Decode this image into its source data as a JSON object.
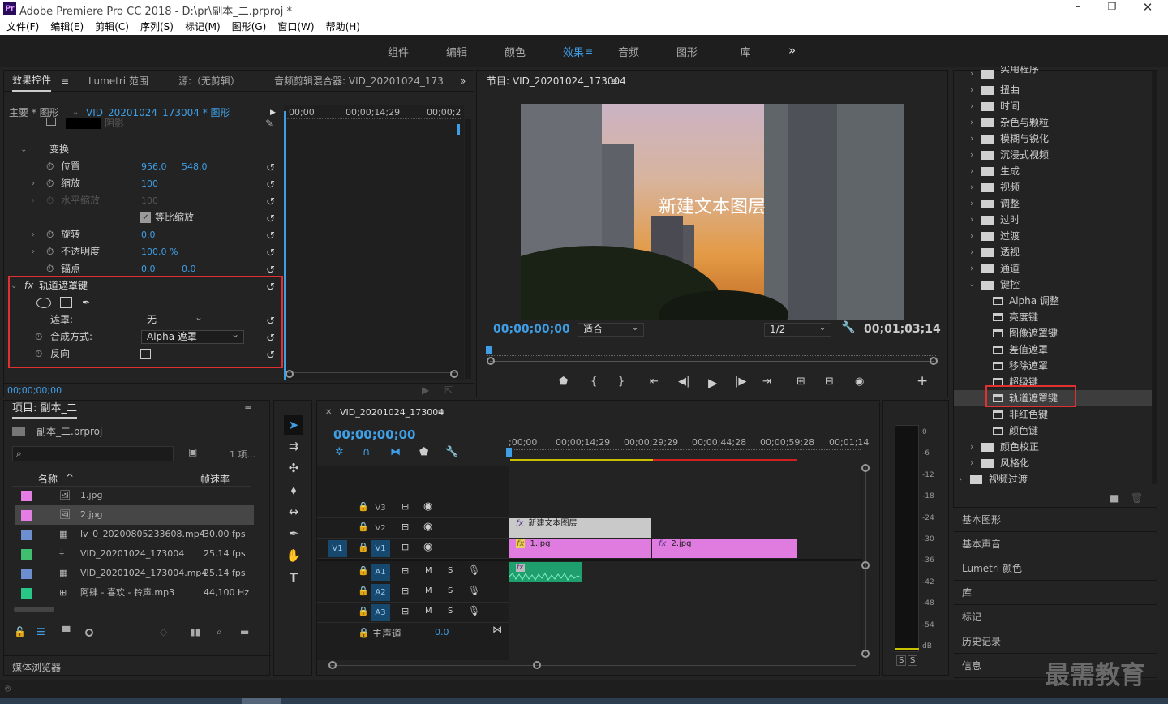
{
  "app": {
    "title": "Adobe Premiere Pro CC 2018 - D:\\pr\\副本_二.prproj *",
    "logo": "Pr"
  },
  "menu": [
    "文件(F)",
    "编辑(E)",
    "剪辑(C)",
    "序列(S)",
    "标记(M)",
    "图形(G)",
    "窗口(W)",
    "帮助(H)"
  ],
  "workspaces": {
    "tabs": [
      "组件",
      "编辑",
      "颜色",
      "效果",
      "音频",
      "图形",
      "库"
    ],
    "active": "效果",
    "more": "»"
  },
  "effect_controls": {
    "tabs": [
      "效果控件",
      "Lumetri 范围",
      "源:（无剪辑）",
      "音频剪辑混合器: VID_20201024_173004"
    ],
    "clip_master": "主要 * 图形",
    "clip_name": "VID_20201024_173004 * 图形",
    "shadow": "阴影",
    "transform": "变换",
    "position_label": "位置",
    "position_x": "956.0",
    "position_y": "548.0",
    "scale_label": "缩放",
    "scale": "100",
    "scale_w_label": "水平缩放",
    "scale_w": "100",
    "uniform_label": "等比缩放",
    "rotation_label": "旋转",
    "rotation": "0.0",
    "opacity_label": "不透明度",
    "opacity": "100.0 %",
    "anchor_label": "锚点",
    "anchor_x": "0.0",
    "anchor_y": "0.0",
    "fx": "fx",
    "track_matte_label": "轨道遮罩键",
    "matte_label": "遮罩:",
    "matte_value": "无",
    "composite_label": "合成方式:",
    "composite_value": "Alpha 遮罩",
    "reverse_label": "反向",
    "timecode": "00;00;00;00",
    "mini_ruler": [
      "00;00",
      "00;00;14;29",
      "00;00;2"
    ]
  },
  "program": {
    "title": "节目: VID_20201024_173004",
    "overlay_text": "新建文本图层",
    "timecode": "00;00;00;00",
    "fit": "适合",
    "res": "1/2",
    "duration": "00;01;03;14"
  },
  "effects_panel": {
    "items": [
      {
        "label": "实用程序",
        "kind": "folder",
        "partial": true
      },
      {
        "label": "扭曲",
        "kind": "folder"
      },
      {
        "label": "时间",
        "kind": "folder"
      },
      {
        "label": "杂色与颗粒",
        "kind": "folder"
      },
      {
        "label": "模糊与锐化",
        "kind": "folder"
      },
      {
        "label": "沉浸式视频",
        "kind": "folder"
      },
      {
        "label": "生成",
        "kind": "folder"
      },
      {
        "label": "视频",
        "kind": "folder"
      },
      {
        "label": "调整",
        "kind": "folder"
      },
      {
        "label": "过时",
        "kind": "folder"
      },
      {
        "label": "过渡",
        "kind": "folder"
      },
      {
        "label": "透视",
        "kind": "folder"
      },
      {
        "label": "通道",
        "kind": "folder"
      },
      {
        "label": "键控",
        "kind": "open"
      },
      {
        "label": "Alpha 调整",
        "kind": "effect"
      },
      {
        "label": "亮度键",
        "kind": "effect"
      },
      {
        "label": "图像遮罩键",
        "kind": "effect"
      },
      {
        "label": "差值遮罩",
        "kind": "effect"
      },
      {
        "label": "移除遮罩",
        "kind": "effect"
      },
      {
        "label": "超级键",
        "kind": "effect"
      },
      {
        "label": "轨道遮罩键",
        "kind": "effect",
        "selected": true
      },
      {
        "label": "非红色键",
        "kind": "effect"
      },
      {
        "label": "颜色键",
        "kind": "effect"
      },
      {
        "label": "颜色校正",
        "kind": "folder"
      },
      {
        "label": "风格化",
        "kind": "folder"
      },
      {
        "label": "视频过渡",
        "kind": "root"
      }
    ],
    "collapsed_panels": [
      "基本图形",
      "基本声音",
      "Lumetri 颜色",
      "库",
      "标记",
      "历史记录",
      "信息"
    ]
  },
  "project": {
    "title": "项目: 副本_二",
    "file": "副本_二.prproj",
    "count": "1 项...",
    "col_name": "名称",
    "col_rate": "帧速率",
    "items": [
      {
        "name": "1.jpg",
        "rate": "",
        "color": "#e47ee4",
        "icon": "image"
      },
      {
        "name": "2.jpg",
        "rate": "",
        "color": "#e47ee4",
        "icon": "image"
      },
      {
        "name": "lv_0_20200805233608.mp4",
        "rate": "30.00 fps",
        "color": "#6d8fd0",
        "icon": "video"
      },
      {
        "name": "VID_20201024_173004",
        "rate": "25.14 fps",
        "color": "#3fbf6f",
        "icon": "sequence"
      },
      {
        "name": "VID_20201024_173004.mp4",
        "rate": "25.14 fps",
        "color": "#6d8fd0",
        "icon": "video"
      },
      {
        "name": "阿肆 - 喜欢 - 铃声.mp3",
        "rate": "44,100 Hz",
        "color": "#28c788",
        "icon": "audio"
      }
    ],
    "media_browser": "媒体浏览器"
  },
  "timeline": {
    "seq_name": "VID_20201024_173004",
    "timecode": "00;00;00;00",
    "ruler": [
      ";00;00",
      "00;00;14;29",
      "00;00;29;29",
      "00;00;44;28",
      "00;00;59;28",
      "00;01;14"
    ],
    "tracks": {
      "v": [
        "V3",
        "V2",
        "V1"
      ],
      "a": [
        "A1",
        "A2",
        "A3"
      ],
      "src_v": "V1",
      "master": "主声道",
      "master_val": "0.0",
      "m": "M",
      "s": "S"
    },
    "clips": {
      "text": "新建文本图层",
      "img1": "1.jpg",
      "img2": "2.jpg",
      "fx": "fx"
    }
  },
  "meter": {
    "labels": [
      "0",
      "-6",
      "-12",
      "-18",
      "-24",
      "-30",
      "-36",
      "-42",
      "-48",
      "-54",
      "dB"
    ],
    "solo": [
      "S",
      "S"
    ]
  },
  "watermark": "最需教育"
}
